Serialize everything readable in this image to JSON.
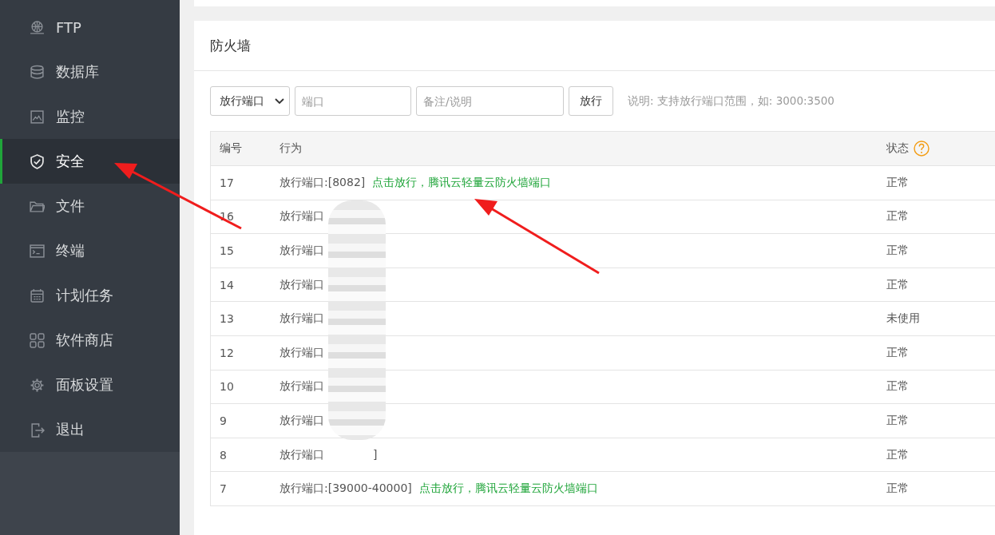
{
  "sidebar": {
    "items": [
      {
        "label": "FTP",
        "selected": false
      },
      {
        "label": "数据库",
        "selected": false
      },
      {
        "label": "监控",
        "selected": false
      },
      {
        "label": "安全",
        "selected": true
      },
      {
        "label": "文件",
        "selected": false
      },
      {
        "label": "终端",
        "selected": false
      },
      {
        "label": "计划任务",
        "selected": false
      },
      {
        "label": "软件商店",
        "selected": false
      },
      {
        "label": "面板设置",
        "selected": false
      },
      {
        "label": "退出",
        "selected": false
      }
    ]
  },
  "panel": {
    "title": "防火墙",
    "toolbar": {
      "mode": "放行端口",
      "port_placeholder": "端口",
      "note_placeholder": "备注/说明",
      "button": "放行",
      "hint": "说明: 支持放行端口范围，如: 3000:3500"
    },
    "table": {
      "columns": [
        "编号",
        "行为",
        "状态"
      ],
      "rows": [
        {
          "id": "17",
          "action": "放行端口:[8082]",
          "note": "点击放行，腾讯云轻量云防火墙端口",
          "status": "正常"
        },
        {
          "id": "16",
          "action": "放行端口",
          "status": "正常"
        },
        {
          "id": "15",
          "action": "放行端口",
          "status": "正常"
        },
        {
          "id": "14",
          "action": "放行端口",
          "status": "正常"
        },
        {
          "id": "13",
          "action": "放行端口",
          "status": "未使用"
        },
        {
          "id": "12",
          "action": "放行端口",
          "status": "正常"
        },
        {
          "id": "10",
          "action": "放行端口",
          "status": "正常"
        },
        {
          "id": "9",
          "action": "放行端口",
          "status": "正常"
        },
        {
          "id": "8",
          "action": "放行端口",
          "tail": "]",
          "status": "正常"
        },
        {
          "id": "7",
          "action": "放行端口:[39000-40000]",
          "note": "点击放行，腾讯云轻量云防火墙端口",
          "status": "正常"
        }
      ]
    }
  }
}
